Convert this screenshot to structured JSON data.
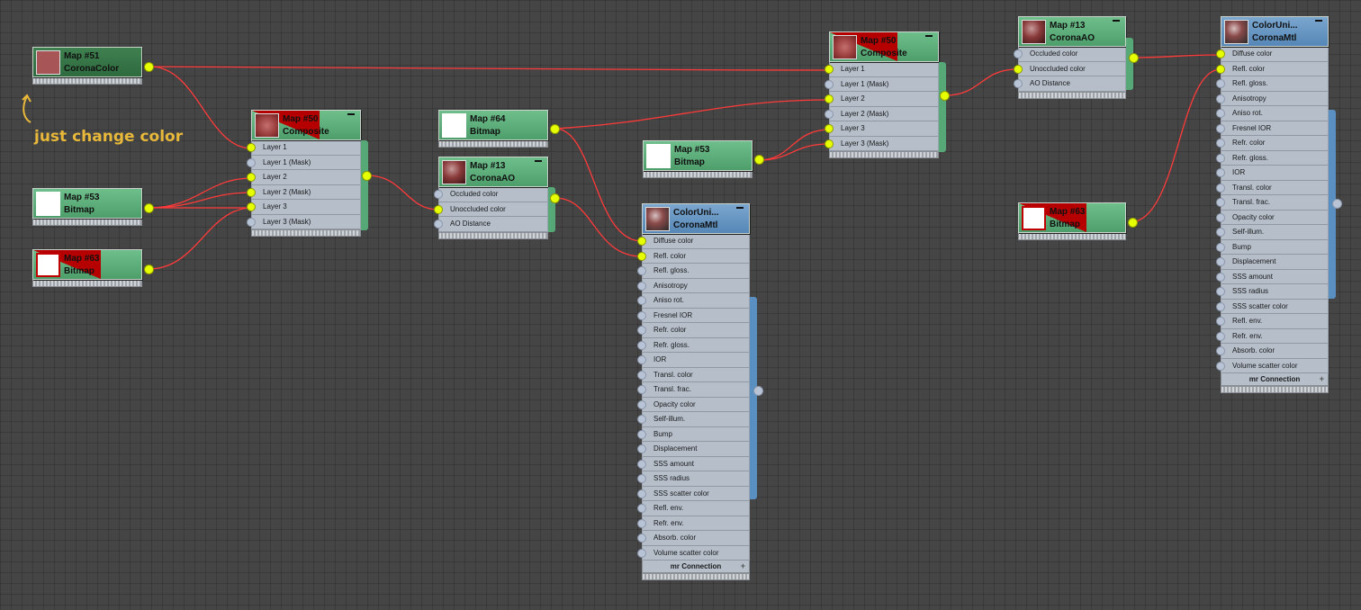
{
  "annotation": {
    "text": "just change color"
  },
  "nodes": {
    "map51": {
      "title": "Map #51",
      "subtitle": "CoronaColor"
    },
    "map53a": {
      "title": "Map #53",
      "subtitle": "Bitmap"
    },
    "map63a": {
      "title": "Map #63",
      "subtitle": "Bitmap"
    },
    "map50a": {
      "title": "Map #50",
      "subtitle": "Composite",
      "slots": [
        "Layer 1",
        "Layer 1 (Mask)",
        "Layer 2",
        "Layer 2 (Mask)",
        "Layer 3",
        "Layer 3 (Mask)"
      ]
    },
    "map64": {
      "title": "Map #64",
      "subtitle": "Bitmap"
    },
    "map13a": {
      "title": "Map #13",
      "subtitle": "CoronaAO",
      "slots": [
        "Occluded color",
        "Unoccluded color",
        "AO Distance"
      ]
    },
    "map53b": {
      "title": "Map #53",
      "subtitle": "Bitmap"
    },
    "mtl1": {
      "title": "ColorUni...",
      "subtitle": "CoronaMtl",
      "slots": [
        "Diffuse color",
        "Refl. color",
        "Refl. gloss.",
        "Anisotropy",
        "Aniso rot.",
        "Fresnel IOR",
        "Refr. color",
        "Refr. gloss.",
        "IOR",
        "Transl. color",
        "Transl. frac.",
        "Opacity color",
        "Self-illum.",
        "Bump",
        "Displacement",
        "SSS amount",
        "SSS radius",
        "SSS scatter color",
        "Refl. env.",
        "Refr. env.",
        "Absorb. color",
        "Volume scatter color"
      ],
      "footer": "mr Connection",
      "footer_plus": "+"
    },
    "map50b": {
      "title": "Map #50",
      "subtitle": "Composite",
      "slots": [
        "Layer 1",
        "Layer 1 (Mask)",
        "Layer 2",
        "Layer 2 (Mask)",
        "Layer 3",
        "Layer 3 (Mask)"
      ]
    },
    "map13b": {
      "title": "Map #13",
      "subtitle": "CoronaAO",
      "slots": [
        "Occluded color",
        "Unoccluded color",
        "AO Distance"
      ]
    },
    "map63b": {
      "title": "Map #63",
      "subtitle": "Bitmap"
    },
    "mtl2": {
      "title": "ColorUni...",
      "subtitle": "CoronaMtl",
      "slots": [
        "Diffuse color",
        "Refl. color",
        "Refl. gloss.",
        "Anisotropy",
        "Aniso rot.",
        "Fresnel IOR",
        "Refr. color",
        "Refr. gloss.",
        "IOR",
        "Transl. color",
        "Transl. frac.",
        "Opacity color",
        "Self-illum.",
        "Bump",
        "Displacement",
        "SSS amount",
        "SSS radius",
        "SSS scatter color",
        "Refl. env.",
        "Refr. env.",
        "Absorb. color",
        "Volume scatter color"
      ],
      "footer": "mr Connection",
      "footer_plus": "+"
    }
  },
  "colors": {
    "wire": "#ff3a3a",
    "port_connected": "#e6ff00",
    "node_green": "#5aa878",
    "node_blue": "#6a98c4"
  }
}
